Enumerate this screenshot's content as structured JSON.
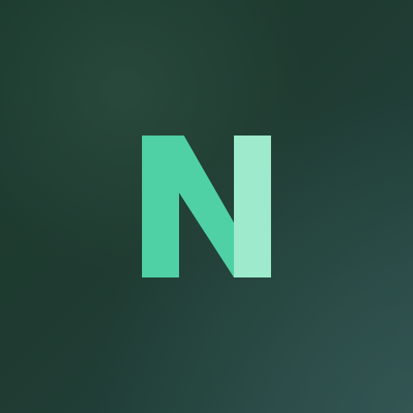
{
  "logo": {
    "icon": "letter-n-logo",
    "colors": {
      "primary": "#4fd1a5",
      "secondary": "#9eeacc"
    }
  },
  "background": {
    "colors": {
      "top_left": "#1c3a2f",
      "bottom_right": "#29474a"
    }
  }
}
